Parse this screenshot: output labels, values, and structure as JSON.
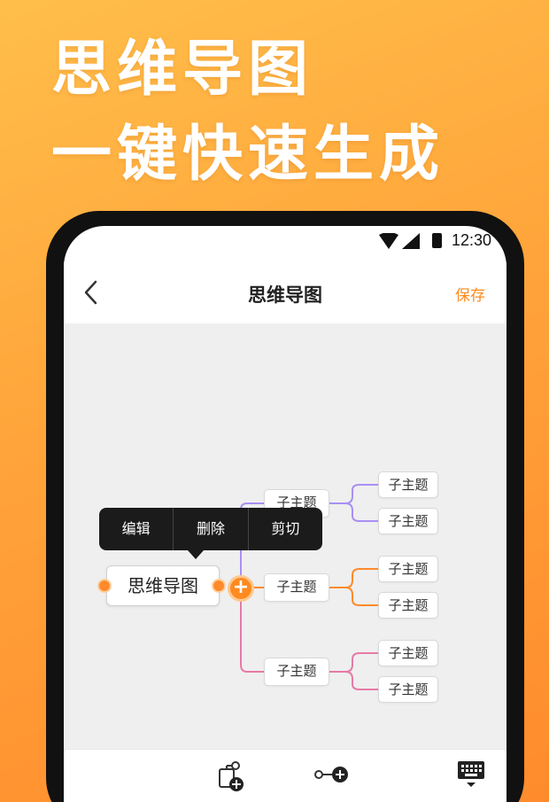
{
  "promo": {
    "line1": "思维导图",
    "line2": "一键快速生成"
  },
  "status_bar": {
    "time": "12:30"
  },
  "nav": {
    "title": "思维导图",
    "save_label": "保存"
  },
  "popup_menu": {
    "items": [
      "编辑",
      "删除",
      "剪切"
    ]
  },
  "mindmap": {
    "root": "思维导图",
    "branches": [
      {
        "label": "子主题",
        "color": "#a98ff5",
        "children": [
          "子主题",
          "子主题"
        ]
      },
      {
        "label": "子主题",
        "color": "#ff8a2b",
        "children": [
          "子主题",
          "子主题"
        ]
      },
      {
        "label": "子主题",
        "color": "#e77aa6",
        "children": [
          "子主题",
          "子主题"
        ]
      }
    ]
  },
  "colors": {
    "accent": "#ff8a1f",
    "background_top": "#ffbe4a",
    "background_bottom": "#ff8b2c"
  },
  "toolbar": {
    "icons": [
      "add-child-node-icon",
      "add-sibling-node-icon",
      "keyboard-icon"
    ]
  }
}
